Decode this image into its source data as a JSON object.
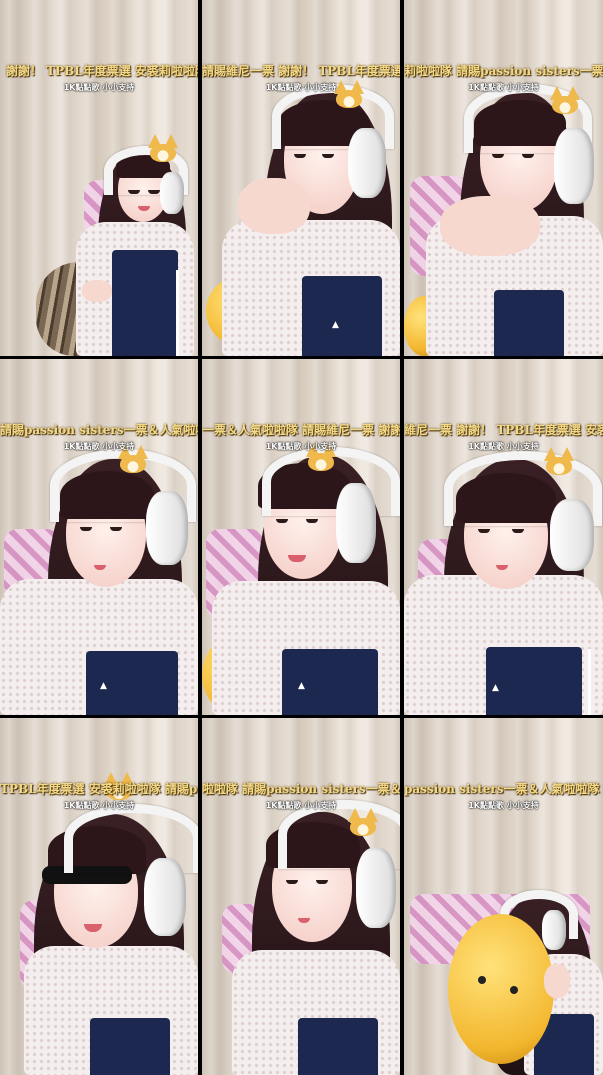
{
  "frames": [
    {
      "ticker": "：謝謝！ TPBL年度票選 安裘莉啦啦隊 請賜維尼一票 謝謝！ TPBL年度票選 安裘莉啦啦隊 請賜",
      "ticker_offset": "-10",
      "support": "1K點點歌 小小支持"
    },
    {
      "ticker": "請賜維尼一票 謝謝！ TPBL年度票選 安裘莉啦啦隊 請賜passion sisters",
      "support": "1K點點歌 小小支持"
    },
    {
      "ticker": "莉啦啦隊 請賜passion sisters一票＆人氣啦啦隊 請賜維尼一票",
      "support": "1K點點歌 小小支持"
    },
    {
      "ticker": "請賜passion sisters一票＆人氣啦啦隊 請賜維尼一票 謝謝！",
      "support": "1K點點歌 小小支持"
    },
    {
      "ticker": "一票＆人氣啦啦隊 請賜維尼一票 謝謝！ TPBL年度票選",
      "support": "1K點點歌 小小支持"
    },
    {
      "ticker": "維尼一票 謝謝！ TPBL年度票選 安裘莉啦啦",
      "support": "1K點點歌 小小支持"
    },
    {
      "ticker": "TPBL年度票選 安裘莉啦啦隊 請賜passion sisters",
      "support": "1K點點歌 小小支持"
    },
    {
      "ticker": "啦啦隊 請賜passion sisters一票＆人氣啦啦隊 請賜",
      "support": "1K點點歌 小小支持"
    },
    {
      "ticker": "passion sisters一票＆人氣啦啦隊 請賜維尼一票",
      "support": "1K點點歌 小小支持"
    }
  ],
  "colors": {
    "ticker_gold": "#f2d98a",
    "dress_navy": "#1d2850",
    "headset_white": "#f4f4f4",
    "hair_dark": "#2d1619"
  }
}
